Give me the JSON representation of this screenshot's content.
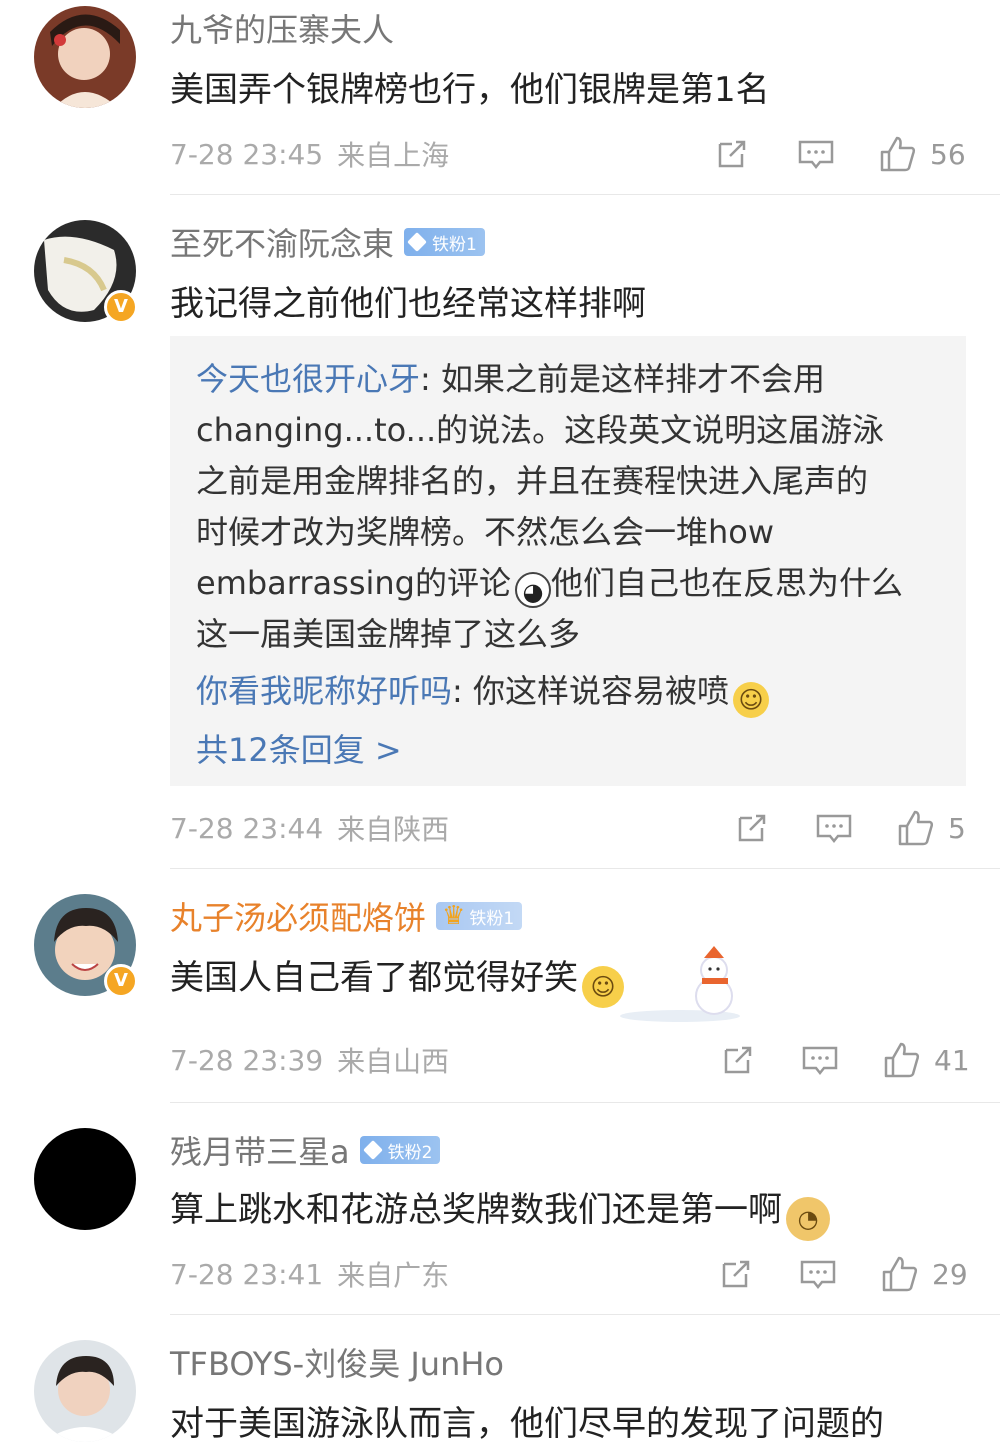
{
  "comments": [
    {
      "username": "九爷的压寨夫人",
      "text": "美国弄个银牌榜也行，他们银牌是第1名",
      "time": "7-28 23:45",
      "source": "来自上海",
      "likes": "56"
    },
    {
      "username": "至死不渝阮念東",
      "badge": "铁粉1",
      "text": "我记得之前他们也经常这样排啊",
      "time": "7-28 23:44",
      "source": "来自陕西",
      "likes": "5",
      "replies": [
        {
          "user": "今天也很开心牙",
          "lines": [
            ": 如果之前是这样排才不会用",
            "changing...to...的说法。这段英文说明这届游泳",
            "之前是用金牌排名的，并且在赛程快进入尾声的",
            "时候才改为奖牌榜。不然怎么会一堆how",
            "embarrassing的评论",
            "他们自己也在反思为什么",
            "这一届美国金牌掉了这么多"
          ]
        },
        {
          "user": "你看我昵称好听吗",
          "text": ": 你这样说容易被喷"
        }
      ],
      "more": "共12条回复 >"
    },
    {
      "username": "丸子汤必须配烙饼",
      "badge": "铁粉1",
      "text": "美国人自己看了都觉得好笑",
      "time": "7-28 23:39",
      "source": "来自山西",
      "likes": "41"
    },
    {
      "username": "残月带三星a",
      "badge": "铁粉2",
      "text": "算上跳水和花游总奖牌数我们还是第一啊",
      "time": "7-28 23:41",
      "source": "来自广东",
      "likes": "29"
    },
    {
      "username": "TFBOYS-刘俊昊 JunHo",
      "text": "对于美国游泳队而言，他们尽早的发现了问题的"
    }
  ],
  "colors": {
    "link": "#4a78b5",
    "orange_name": "#e8822b",
    "meta": "#aaaaaa",
    "reply_bg": "#f4f4f4"
  },
  "icons": [
    "share-icon",
    "comment-icon",
    "like-icon"
  ]
}
